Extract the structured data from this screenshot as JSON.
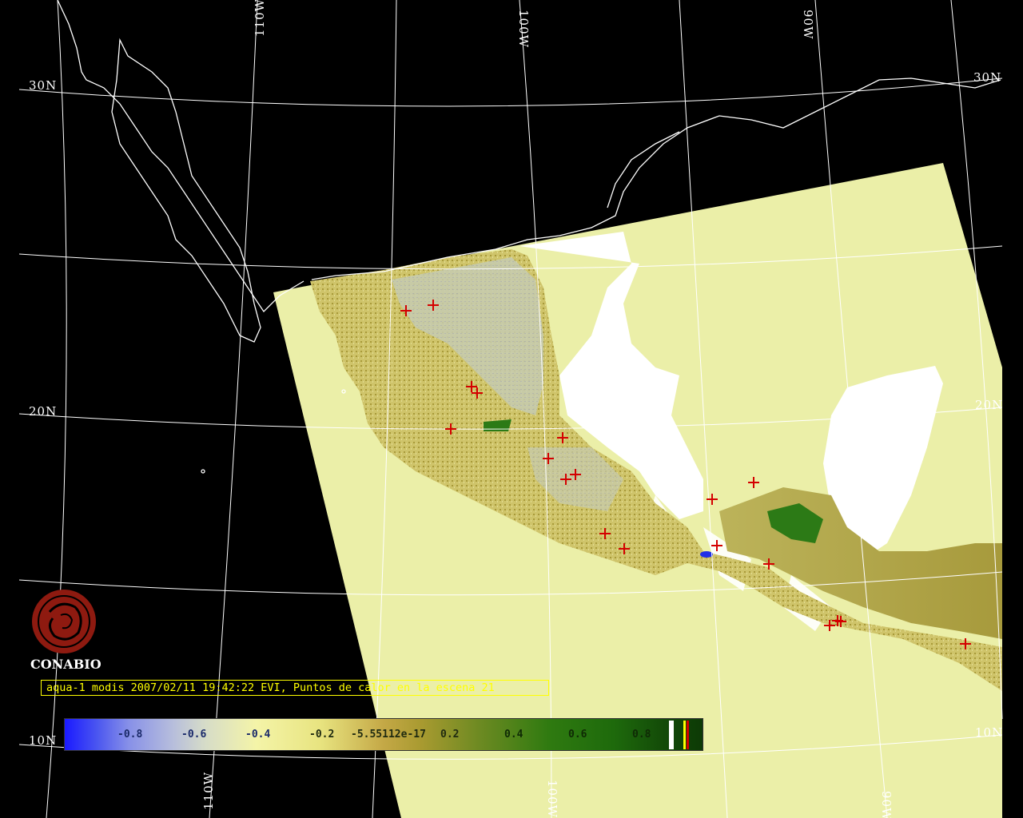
{
  "map": {
    "grid_labels": {
      "lon_110w_top": "110W",
      "lon_100w_top": "100W",
      "lon_90w_top": "90W",
      "lat_30n_left": "30N",
      "lat_30n_right": "30N",
      "lat_20n_left": "20N",
      "lat_20n_right": "20N",
      "lat_10n_left": "10N",
      "lat_10n_right": "10N",
      "lon_110w_bottom": "110W",
      "lon_100w_bottom": "100W",
      "lon_90w_bottom": "90W"
    },
    "colors": {
      "background": "#000000",
      "swath_base": "#ebefa8",
      "cloud_mask": "#ffffff",
      "fire_marker": "#d40000",
      "caption": "#ffff00"
    },
    "hotspot_count": 22
  },
  "branding": {
    "org": "CONABIO",
    "logo_icon": "conabio-logo-icon"
  },
  "caption": {
    "text": "aqua-1 modis 2007/02/11 19:42:22 EVI, Puntos de calor en la escena 21"
  },
  "legend": {
    "ticks": [
      "-0.8",
      "-0.6",
      "-0.4",
      "-0.2",
      "-5.55112e-17",
      "0.2",
      "0.4",
      "0.6",
      "0.8"
    ],
    "end_swatches": [
      "#ffffff",
      "#ffff00",
      "#d40000"
    ]
  }
}
